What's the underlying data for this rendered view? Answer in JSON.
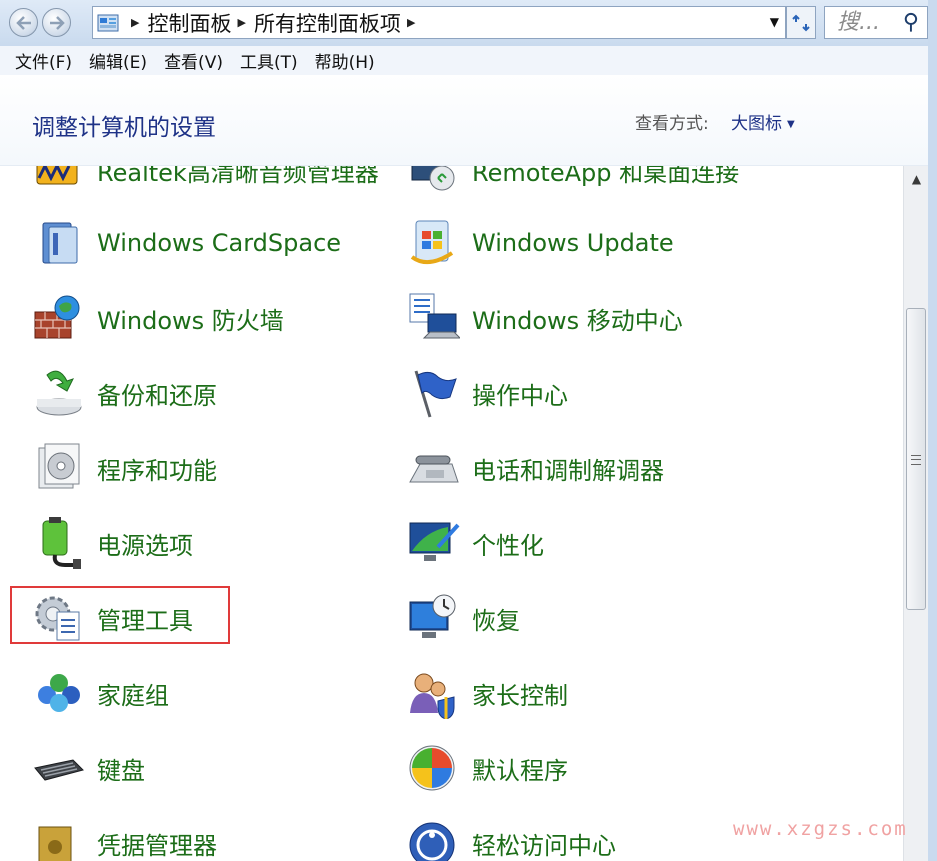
{
  "address": {
    "breadcrumbs": [
      "控制面板",
      "所有控制面板项"
    ],
    "search_placeholder": "搜..."
  },
  "menu": [
    "文件(F)",
    "编辑(E)",
    "查看(V)",
    "工具(T)",
    "帮助(H)"
  ],
  "header": {
    "title": "调整计算机的设置",
    "view_label": "查看方式:",
    "view_value": "大图标"
  },
  "items_left": [
    {
      "label": "Realtek高清晰音频管理器",
      "icon": "realtek-audio-icon"
    },
    {
      "label": "Windows CardSpace",
      "icon": "cardspace-icon"
    },
    {
      "label": "Windows 防火墙",
      "icon": "firewall-icon"
    },
    {
      "label": "备份和还原",
      "icon": "backup-icon"
    },
    {
      "label": "程序和功能",
      "icon": "programs-icon"
    },
    {
      "label": "电源选项",
      "icon": "power-icon"
    },
    {
      "label": "管理工具",
      "icon": "admin-tools-icon"
    },
    {
      "label": "家庭组",
      "icon": "homegroup-icon"
    },
    {
      "label": "键盘",
      "icon": "keyboard-icon"
    },
    {
      "label": "凭据管理器",
      "icon": "credential-icon"
    }
  ],
  "items_right": [
    {
      "label": "RemoteApp 和桌面连接",
      "icon": "remoteapp-icon"
    },
    {
      "label": "Windows Update",
      "icon": "windows-update-icon"
    },
    {
      "label": "Windows 移动中心",
      "icon": "mobility-center-icon"
    },
    {
      "label": "操作中心",
      "icon": "action-center-flag-icon"
    },
    {
      "label": "电话和调制解调器",
      "icon": "phone-modem-icon"
    },
    {
      "label": "个性化",
      "icon": "personalization-icon"
    },
    {
      "label": "恢复",
      "icon": "recovery-icon"
    },
    {
      "label": "家长控制",
      "icon": "parental-controls-icon"
    },
    {
      "label": "默认程序",
      "icon": "default-programs-icon"
    },
    {
      "label": "轻松访问中心",
      "icon": "ease-of-access-icon"
    }
  ],
  "watermark": "www.xzgzs.com"
}
